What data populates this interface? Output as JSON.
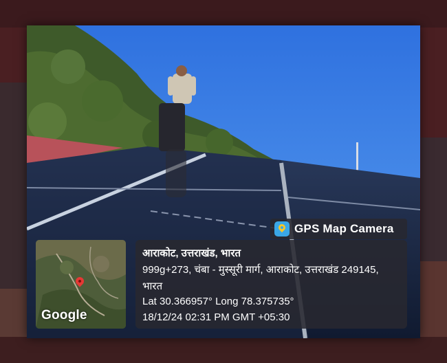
{
  "overlay": {
    "app_name": "GPS Map Camera",
    "map_brand": "Google",
    "place_title": "आराकोट, उत्तराखंड, भारत",
    "address_line": "999g+273, चंबा - मुस्सूरी मार्ग, आराकोट, उत्तराखंड 249145,",
    "address_country": "भारत",
    "coordinates": "Lat 30.366957° Long 78.375735°",
    "timestamp": "18/12/24 02:31 PM GMT +05:30"
  },
  "icons": {
    "app_logo": "map-pin-camera-icon",
    "map_marker": "map-pin-icon"
  },
  "colors": {
    "panel_bg": "#28283099",
    "sky": "#3d7fe0",
    "panel": "#1c2c4a",
    "frame": "#4a1f22"
  }
}
